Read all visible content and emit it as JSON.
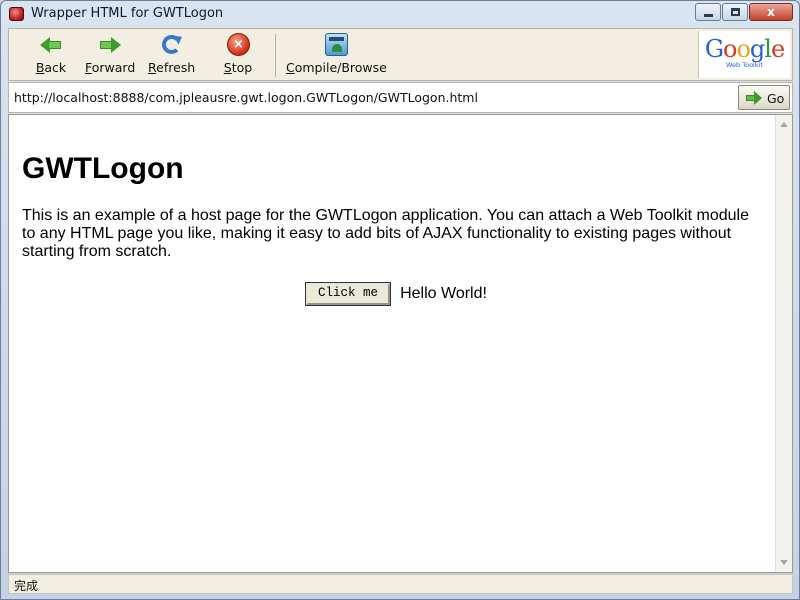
{
  "window": {
    "title": "Wrapper HTML for GWTLogon",
    "close_glyph": "x"
  },
  "toolbar": {
    "back_label": "Back",
    "forward_label": "Forward",
    "refresh_label": "Refresh",
    "stop_label": "Stop",
    "compile_label": "Compile/Browse",
    "stop_glyph": "×"
  },
  "logo": {
    "letters": [
      "G",
      "o",
      "o",
      "g",
      "l",
      "e"
    ],
    "subtitle": "Web Toolkit"
  },
  "address": {
    "url": "http://localhost:8888/com.jpleausre.gwt.logon.GWTLogon/GWTLogon.html",
    "go_label": "Go"
  },
  "page": {
    "heading": "GWTLogon",
    "paragraph": "This is an example of a host page for the GWTLogon application. You can attach a Web Toolkit module to any HTML page you like, making it easy to add bits of AJAX functionality to existing pages without starting from scratch.",
    "button_label": "Click me",
    "hello_text": "Hello World!"
  },
  "status": {
    "text": "完成"
  },
  "icons": [
    "app-icon",
    "back-arrow-icon",
    "forward-arrow-icon",
    "refresh-icon",
    "stop-icon",
    "compile-browse-icon",
    "go-arrow-icon"
  ]
}
